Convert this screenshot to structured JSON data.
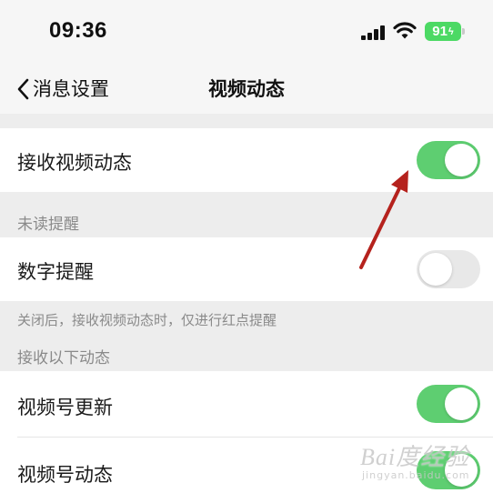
{
  "status_bar": {
    "time": "09:36",
    "battery": "91",
    "battery_color": "#4cd964"
  },
  "nav": {
    "back_label": "消息设置",
    "title": "视频动态",
    "back_icon": "chevron-left-icon"
  },
  "rows": {
    "receive_video_updates": {
      "label": "接收视频动态",
      "toggle_on": true
    },
    "unread_section": "未读提醒",
    "number_reminder": {
      "label": "数字提醒",
      "toggle_on": false
    },
    "number_reminder_note": "关闭后，接收视频动态时，仅进行红点提醒",
    "receive_section": "接收以下动态",
    "channel_update": {
      "label": "视频号更新",
      "toggle_on": true
    },
    "channel_moments": {
      "label": "视频号动态",
      "toggle_on": true
    }
  },
  "colors": {
    "toggle_on": "#5ece71",
    "toggle_off": "#e8e8e8",
    "annotation_arrow": "#b5221d"
  },
  "watermark": {
    "text": "Bai度经验",
    "sub": "jingyan.baidu.com"
  }
}
